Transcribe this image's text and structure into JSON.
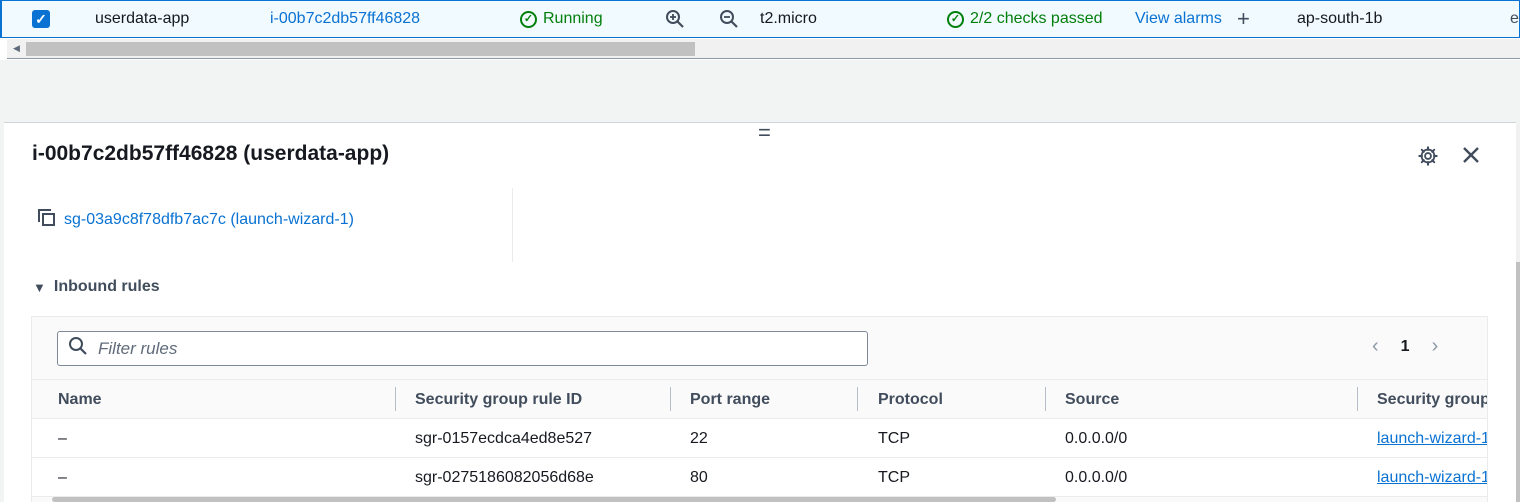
{
  "instance_row": {
    "checked": "✓",
    "name": "userdata-app",
    "instance_id": "i-00b7c2db57ff46828",
    "state": "Running",
    "instance_type": "t2.micro",
    "status_check": "2/2 checks passed",
    "alarms_link": "View alarms",
    "plus": "+",
    "availability_zone": "ap-south-1b",
    "next_col_clip": "ec"
  },
  "panel": {
    "handle": "=",
    "title": "i-00b7c2db57ff46828 (userdata-app)",
    "security_group_link": "sg-03a9c8f78dfb7ac7c (launch-wizard-1)",
    "inbound_section": "Inbound rules",
    "caret": "▼"
  },
  "rules_table": {
    "filter_placeholder": "Filter rules",
    "pager": {
      "prev": "‹",
      "page": "1",
      "next": "›"
    },
    "columns": [
      "Name",
      "Security group rule ID",
      "Port range",
      "Protocol",
      "Source",
      "Security group"
    ],
    "rows": [
      {
        "name": "–",
        "rule_id": "sgr-0157ecdca4ed8e527",
        "port": "22",
        "protocol": "TCP",
        "source": "0.0.0.0/0",
        "security_group": "launch-wizard-1"
      },
      {
        "name": "–",
        "rule_id": "sgr-0275186082056d68e",
        "port": "80",
        "protocol": "TCP",
        "source": "0.0.0.0/0",
        "security_group": "launch-wizard-1"
      }
    ]
  },
  "colors": {
    "link": "#0972d3",
    "success": "#037f0c",
    "selected_row_bg": "#f1faff"
  },
  "icons": [
    "checkbox-checked-icon",
    "status-ok-icon",
    "zoom-in-icon",
    "zoom-out-icon",
    "plus-icon",
    "drag-handle-icon",
    "gear-icon",
    "close-icon",
    "copy-icon",
    "caret-down-icon",
    "search-icon",
    "chevron-left-icon",
    "chevron-right-icon"
  ]
}
